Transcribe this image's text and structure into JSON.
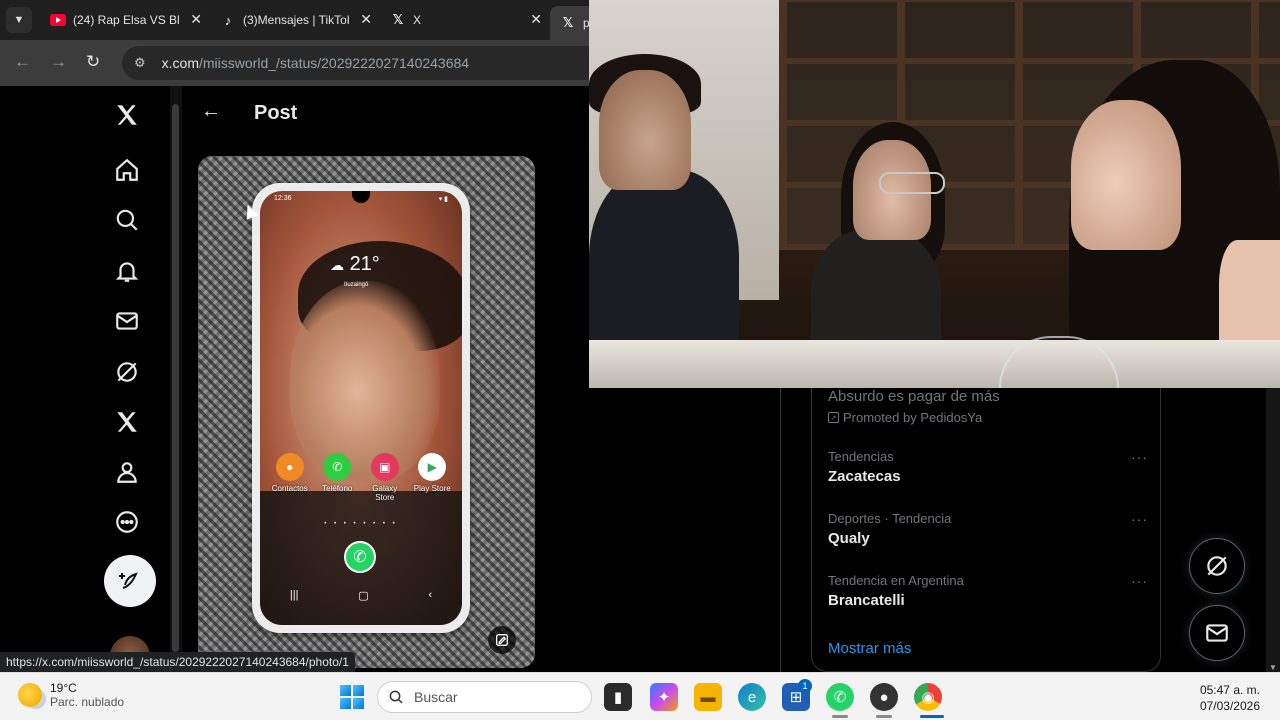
{
  "browser": {
    "tabs": [
      {
        "title": "(24) Rap Elsa VS Bl",
        "icon": "youtube-icon"
      },
      {
        "title": "(3)Mensajes | TikTok",
        "icon": "tiktok-icon"
      },
      {
        "title": "X",
        "icon": "x-logo-icon"
      },
      {
        "title": "p",
        "icon": "x-logo-icon"
      }
    ],
    "url_host": "x.com",
    "url_path": "/miissworld_/status/2029222027140243684",
    "status_url": "https://x.com/miissworld_/status/2029222027140243684/photo/1"
  },
  "post": {
    "header_title": "Post"
  },
  "phone_screen": {
    "time": "12:36",
    "temperature": "21°",
    "location": "Ituzaingó",
    "apps": [
      {
        "label": "Contactos",
        "color": "#f08a24",
        "glyph": "●"
      },
      {
        "label": "Teléfono",
        "color": "#2ecc40",
        "glyph": "✆"
      },
      {
        "label": "Galaxy Store",
        "color": "#e23a5c",
        "glyph": "▣"
      },
      {
        "label": "Play Store",
        "color": "#ffffff",
        "glyph": "▶"
      }
    ]
  },
  "sidebar": {
    "ad_text": "Absurdo es pagar de más",
    "promoted": "Promoted by PedidosYa",
    "trends": [
      {
        "context": "Tendencias",
        "name": "Zacatecas"
      },
      {
        "context": "Deportes · Tendencia",
        "name": "Qualy"
      },
      {
        "context": "Tendencia en Argentina",
        "name": "Brancatelli"
      }
    ],
    "show_more": "Mostrar más"
  },
  "taskbar": {
    "temperature": "19°C",
    "weather_desc": "Parc. nublado",
    "search_placeholder": "Buscar",
    "store_badge": "1",
    "time": "05:47 a. m.",
    "date": "07/03/2026"
  },
  "colors": {
    "x_bg": "#000000",
    "x_text": "#e7e9ea",
    "x_muted": "#71767b",
    "x_link": "#1d9bf0"
  }
}
